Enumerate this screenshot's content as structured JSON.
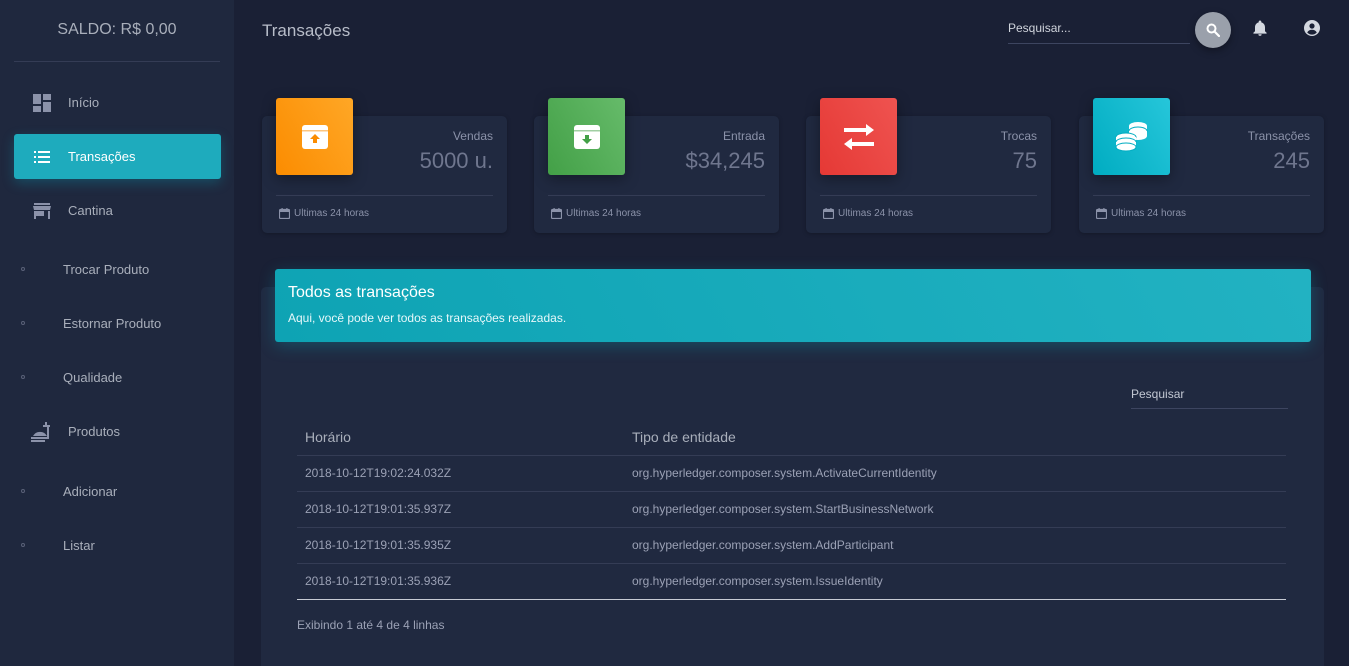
{
  "sidebar": {
    "balance": "SALDO: R$ 0,00",
    "items": [
      {
        "label": "Início",
        "icon": "dashboard-icon"
      },
      {
        "label": "Transações",
        "icon": "list-icon",
        "active": true
      },
      {
        "label": "Cantina",
        "icon": "store-icon"
      },
      {
        "label": "Trocar Produto"
      },
      {
        "label": "Estornar Produto"
      },
      {
        "label": "Qualidade"
      },
      {
        "label": "Produtos",
        "icon": "room-service-icon"
      },
      {
        "label": "Adicionar"
      },
      {
        "label": "Listar"
      }
    ]
  },
  "header": {
    "title": "Transações",
    "search_placeholder": "Pesquisar...",
    "icons": [
      "search-icon",
      "notifications-icon",
      "account-icon"
    ]
  },
  "stats": [
    {
      "category": "Vendas",
      "value": "5000 u.",
      "footer": "Ultimas 24 horas",
      "color": "#fb8c00",
      "icon": "archive-up-icon"
    },
    {
      "category": "Entrada",
      "value": "$34,245",
      "footer": "Ultimas 24 horas",
      "color": "#43a047",
      "icon": "archive-down-icon"
    },
    {
      "category": "Trocas",
      "value": "75",
      "footer": "Ultimas 24 horas",
      "color": "#e53935",
      "icon": "swap-icon"
    },
    {
      "category": "Transações",
      "value": "245",
      "footer": "Ultimas 24 horas",
      "color": "#00acc1",
      "icon": "coins-icon"
    }
  ],
  "panel": {
    "title": "Todos as transações",
    "subtitle": "Aqui, você pode ver todos as transações realizadas.",
    "search_placeholder": "Pesquisar",
    "columns": [
      "Horário",
      "Tipo de entidade"
    ],
    "rows": [
      [
        "2018-10-12T19:02:24.032Z",
        "org.hyperledger.composer.system.ActivateCurrentIdentity"
      ],
      [
        "2018-10-12T19:01:35.937Z",
        "org.hyperledger.composer.system.StartBusinessNetwork"
      ],
      [
        "2018-10-12T19:01:35.935Z",
        "org.hyperledger.composer.system.AddParticipant"
      ],
      [
        "2018-10-12T19:01:35.936Z",
        "org.hyperledger.composer.system.IssueIdentity"
      ]
    ],
    "footer": "Exibindo 1 até 4 de 4 linhas"
  },
  "colors": {
    "background": "#1a2035",
    "sidebar": "#1f283e",
    "card": "#202940",
    "accent": "#1eabbd"
  }
}
